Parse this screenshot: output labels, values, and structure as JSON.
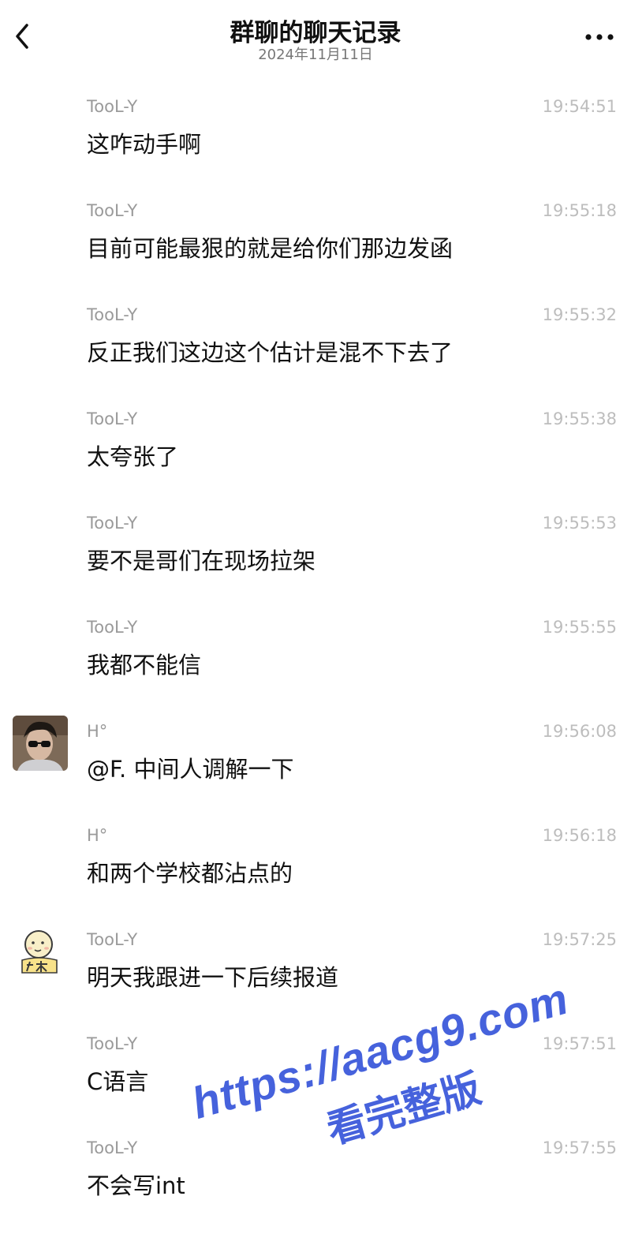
{
  "header": {
    "title": "群聊的聊天记录",
    "date": "2024年11月11日"
  },
  "messages": [
    {
      "sender": "TooL-Y",
      "time": "19:54:51",
      "text": "这咋动手啊",
      "avatar": ""
    },
    {
      "sender": "TooL-Y",
      "time": "19:55:18",
      "text": "目前可能最狠的就是给你们那边发函",
      "avatar": ""
    },
    {
      "sender": "TooL-Y",
      "time": "19:55:32",
      "text": "反正我们这边这个估计是混不下去了",
      "avatar": ""
    },
    {
      "sender": "TooL-Y",
      "time": "19:55:38",
      "text": "太夸张了",
      "avatar": ""
    },
    {
      "sender": "TooL-Y",
      "time": "19:55:53",
      "text": "要不是哥们在现场拉架",
      "avatar": ""
    },
    {
      "sender": "TooL-Y",
      "time": "19:55:55",
      "text": "我都不能信",
      "avatar": ""
    },
    {
      "sender": "H°",
      "time": "19:56:08",
      "text": "@F. 中间人调解一下",
      "avatar": "photo"
    },
    {
      "sender": "H°",
      "time": "19:56:18",
      "text": "和两个学校都沾点的",
      "avatar": ""
    },
    {
      "sender": "TooL-Y",
      "time": "19:57:25",
      "text": "明天我跟进一下后续报道",
      "avatar": "cartoon"
    },
    {
      "sender": "TooL-Y",
      "time": "19:57:51",
      "text": "C语言",
      "avatar": ""
    },
    {
      "sender": "TooL-Y",
      "time": "19:57:55",
      "text": "不会写int",
      "avatar": ""
    }
  ],
  "watermark": {
    "url": "https://aacg9.com",
    "label": "看完整版"
  },
  "colors": {
    "watermark": "#2d4dd8",
    "timestamp": "#bdbdbd",
    "sender": "#9a9a9a"
  }
}
